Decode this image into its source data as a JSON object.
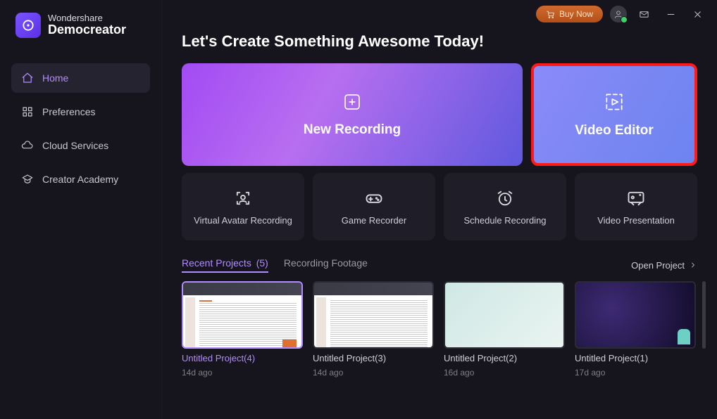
{
  "brand": {
    "company": "Wondershare",
    "product": "Democreator"
  },
  "titlebar": {
    "buy_label": "Buy Now"
  },
  "sidebar": {
    "items": [
      {
        "label": "Home"
      },
      {
        "label": "Preferences"
      },
      {
        "label": "Cloud Services"
      },
      {
        "label": "Creator Academy"
      }
    ]
  },
  "headline": "Let's Create Something Awesome Today!",
  "primary_cards": {
    "new_recording": "New Recording",
    "video_editor": "Video Editor"
  },
  "secondary_cards": [
    {
      "label": "Virtual Avatar Recording"
    },
    {
      "label": "Game Recorder"
    },
    {
      "label": "Schedule Recording"
    },
    {
      "label": "Video Presentation"
    }
  ],
  "tabs": {
    "recent_label": "Recent Projects",
    "recent_count": "(5)",
    "footage_label": "Recording Footage",
    "open_project": "Open Project"
  },
  "projects": [
    {
      "name": "Untitled Project(4)",
      "meta": "14d ago"
    },
    {
      "name": "Untitled Project(3)",
      "meta": "14d ago"
    },
    {
      "name": "Untitled Project(2)",
      "meta": "16d ago"
    },
    {
      "name": "Untitled Project(1)",
      "meta": "17d ago"
    }
  ]
}
